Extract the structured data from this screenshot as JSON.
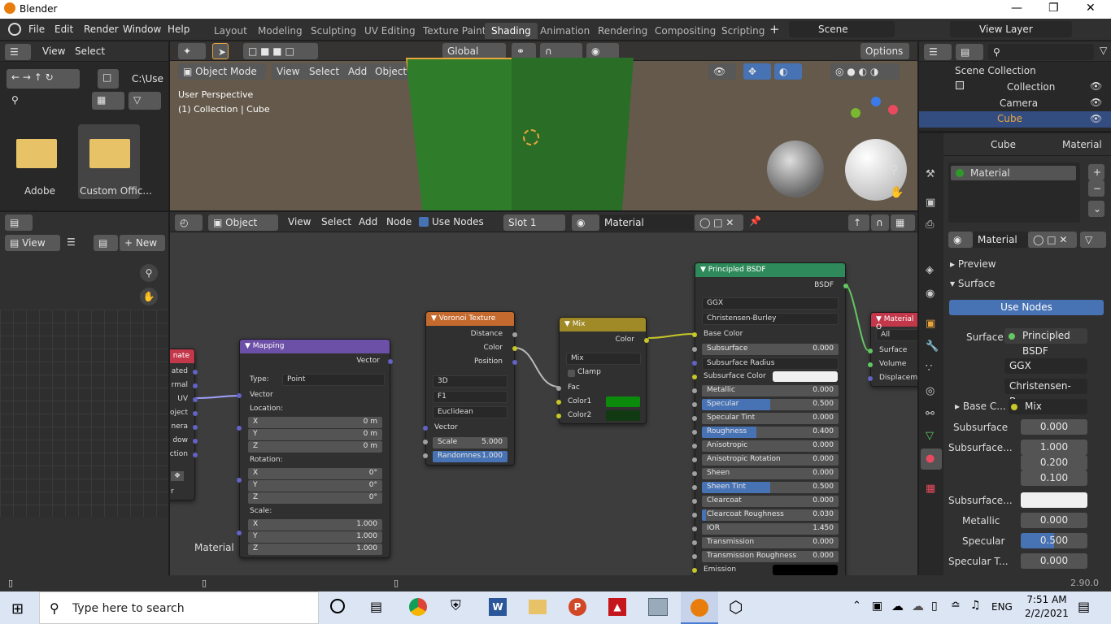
{
  "app_title": "Blender",
  "menu": [
    "File",
    "Edit",
    "Render",
    "Window",
    "Help"
  ],
  "workspace_tabs": [
    "Layout",
    "Modeling",
    "Sculpting",
    "UV Editing",
    "Texture Paint",
    "Shading",
    "Animation",
    "Rendering",
    "Compositing",
    "Scripting"
  ],
  "active_tab": "Shading",
  "scene": "Scene",
  "view_layer": "View Layer",
  "file_browser": {
    "view": "View",
    "select": "Select",
    "path": "C:\\Use",
    "folders": [
      "Adobe",
      "Custom Offic..."
    ]
  },
  "viewport": {
    "mode": "Object Mode",
    "menus": [
      "View",
      "Select",
      "Add",
      "Object"
    ],
    "transform": "Global",
    "options": "Options",
    "perspective": "User Perspective",
    "collection_label": "(1) Collection | Cube"
  },
  "image_editor": {
    "view": "View",
    "new": "New"
  },
  "node_editor": {
    "object": "Object",
    "menus": [
      "View",
      "Select",
      "Add",
      "Node"
    ],
    "use_nodes": "Use Nodes",
    "slot": "Slot 1",
    "material": "Material",
    "frame_label": "Material"
  },
  "nodes": {
    "texcoord": {
      "title": "nate",
      "outputs": [
        "ated",
        "rmal",
        "UV",
        "oject",
        "nera",
        "dow",
        "ction"
      ],
      "bottom": "r"
    },
    "mapping": {
      "title": "Mapping",
      "vector_out": "Vector",
      "type_label": "Type:",
      "type": "Point",
      "vector_in": "Vector",
      "location": "Location:",
      "loc": [
        "0 m",
        "0 m",
        "0 m"
      ],
      "rotation": "Rotation:",
      "rot": [
        "0°",
        "0°",
        "0°"
      ],
      "scale": "Scale:",
      "scl": [
        "1.000",
        "1.000",
        "1.000"
      ],
      "axes": [
        "X",
        "Y",
        "Z"
      ]
    },
    "voronoi": {
      "title": "Voronoi Texture",
      "outputs": [
        "Distance",
        "Color",
        "Position"
      ],
      "dim": "3D",
      "feature": "F1",
      "metric": "Euclidean",
      "vector": "Vector",
      "scale_label": "Scale",
      "scale": "5.000",
      "rand_label": "Randomnes",
      "rand": "1.000"
    },
    "mix": {
      "title": "Mix",
      "output": "Color",
      "blend": "Mix",
      "clamp": "Clamp",
      "fac": "Fac",
      "color1": "Color1",
      "color2": "Color2",
      "c1": "#0b8a0b",
      "c2": "#123a12"
    },
    "bsdf": {
      "title": "Principled BSDF",
      "output": "BSDF",
      "dist": "GGX",
      "sss": "Christensen-Burley",
      "base": "Base Color",
      "rows": [
        [
          "Subsurface",
          "0.000",
          0
        ],
        [
          "Subsurface Radius",
          "",
          -1
        ],
        [
          "Subsurface Color",
          "",
          -2
        ],
        [
          "Metallic",
          "0.000",
          0
        ],
        [
          "Specular",
          "0.500",
          0.5
        ],
        [
          "Specular Tint",
          "0.000",
          0
        ],
        [
          "Roughness",
          "0.400",
          0.4
        ],
        [
          "Anisotropic",
          "0.000",
          0
        ],
        [
          "Anisotropic Rotation",
          "0.000",
          0
        ],
        [
          "Sheen",
          "0.000",
          0
        ],
        [
          "Sheen Tint",
          "0.500",
          0.5
        ],
        [
          "Clearcoat",
          "0.000",
          0
        ],
        [
          "Clearcoat Roughness",
          "0.030",
          0.03
        ],
        [
          "IOR",
          "1.450",
          0
        ],
        [
          "Transmission",
          "0.000",
          0
        ],
        [
          "Transmission Roughness",
          "0.000",
          0
        ],
        [
          "Emission",
          "",
          -3
        ]
      ]
    },
    "output": {
      "title": "Material O",
      "target": "All",
      "inputs": [
        "Surface",
        "Volume",
        "Displaceme"
      ]
    }
  },
  "outliner": {
    "root": "Scene Collection",
    "collection": "Collection",
    "items": [
      "Camera",
      "Cube"
    ]
  },
  "properties": {
    "object": "Cube",
    "material_tab": "Material",
    "slot": "Material",
    "mat_name": "Material",
    "preview": "Preview",
    "surface": "Surface",
    "use_nodes": "Use Nodes",
    "surface_label": "Surface",
    "surface_val": "Principled BSDF",
    "dist": "GGX",
    "sss": "Christensen-Bur...",
    "base_label": "Base C...",
    "base_val": "Mix",
    "subsurface_label": "Subsurface",
    "subsurface": "0.000",
    "radius_label": "Subsurface...",
    "radius": [
      "1.000",
      "0.200",
      "0.100"
    ],
    "sss_color_label": "Subsurface...",
    "metallic_label": "Metallic",
    "metallic": "0.000",
    "specular_label": "Specular",
    "specular": "0.500",
    "spec_tint_label": "Specular T...",
    "spec_tint": "0.000"
  },
  "version": "2.90.0",
  "taskbar": {
    "search": "Type here to search",
    "lang": "ENG",
    "time": "7:51 AM",
    "date": "2/2/2021"
  }
}
